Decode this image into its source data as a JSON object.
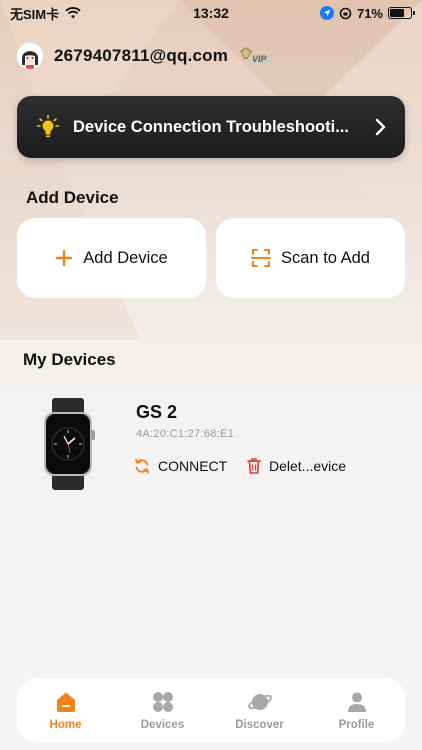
{
  "status_bar": {
    "carrier": "无SIM卡",
    "time": "13:32",
    "battery": "71%"
  },
  "account": {
    "email": "2679407811@qq.com",
    "vip_text": "VIP"
  },
  "banner": {
    "label": "Device Connection Troubleshooti..."
  },
  "add_section": {
    "title": "Add Device",
    "add_button": "Add Device",
    "scan_button": "Scan to Add"
  },
  "devices_section": {
    "title": "My Devices",
    "device": {
      "name": "GS 2",
      "mac": "4A:20:C1:27:68:E1",
      "connect_label": "CONNECT",
      "delete_label": "Delet...evice"
    }
  },
  "tabs": [
    {
      "label": "Home",
      "icon": "home-icon",
      "active": true
    },
    {
      "label": "Devices",
      "icon": "grid-icon",
      "active": false
    },
    {
      "label": "Discover",
      "icon": "planet-icon",
      "active": false
    },
    {
      "label": "Profile",
      "icon": "user-icon",
      "active": false
    }
  ],
  "colors": {
    "accent": "#f3821e",
    "delete": "#e03a3a",
    "banner_bg": "#222222"
  }
}
